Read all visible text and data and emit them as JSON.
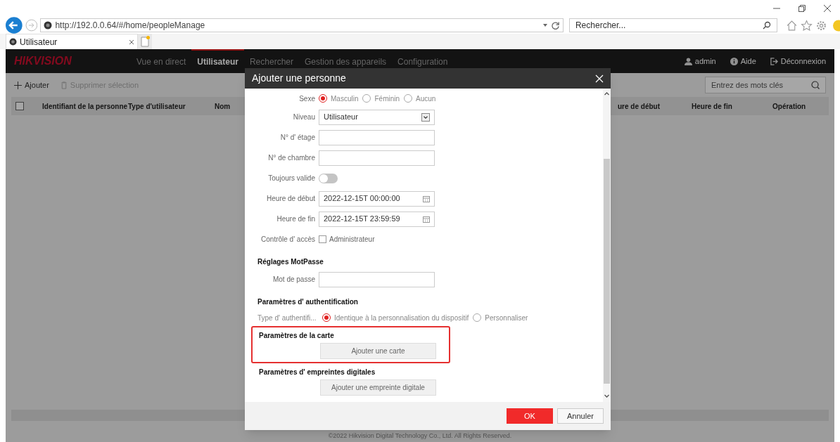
{
  "browser": {
    "url": "http://192.0.0.64/#/home/peopleManage",
    "search_placeholder": "Rechercher...",
    "tab_title": "Utilisateur"
  },
  "app": {
    "logo": "HIKVISION",
    "nav": [
      {
        "label": "Vue en direct",
        "selected": false
      },
      {
        "label": "Utilisateur",
        "selected": true
      },
      {
        "label": "Rechercher",
        "selected": false
      },
      {
        "label": "Gestion des appareils",
        "selected": false
      },
      {
        "label": "Configuration",
        "selected": false
      }
    ],
    "user": "admin",
    "help": "Aide",
    "logout": "Déconnexion"
  },
  "toolbar": {
    "add": "Ajouter",
    "delete": "Supprimer sélection",
    "search_placeholder": "Entrez des mots clés"
  },
  "table": {
    "select_all_checked": false,
    "columns": [
      "Identifiant de la personne",
      "Type d'utilisateur",
      "Nom",
      "ure de début",
      "Heure de fin",
      "Opération"
    ]
  },
  "dialog": {
    "title": "Ajouter une personne",
    "fields": [
      {
        "kind": "radio",
        "label": "Sexe",
        "options": [
          {
            "label": "Masculin",
            "selected": true
          },
          {
            "label": "Féminin",
            "selected": false
          },
          {
            "label": "Aucun",
            "selected": false
          }
        ]
      },
      {
        "kind": "select",
        "label": "Niveau",
        "value": "Utilisateur"
      },
      {
        "kind": "text",
        "label": "N° d'  étage"
      },
      {
        "kind": "text",
        "label": "N° de chambre"
      },
      {
        "kind": "toggle",
        "label": "Toujours valide",
        "on": false
      },
      {
        "kind": "date",
        "label": "Heure de début",
        "value": "2022-12-15T 00:00:00"
      },
      {
        "kind": "date",
        "label": "Heure de fin",
        "value": "2022-12-15T 23:59:59"
      },
      {
        "kind": "checkbox",
        "label": "Contrôle d'  accès",
        "option": "Administrateur",
        "checked": false
      },
      {
        "kind": "section",
        "title": "Réglages MotPasse"
      },
      {
        "kind": "text",
        "label": "Mot de passe"
      },
      {
        "kind": "section",
        "title": "Paramètres d'  authentification"
      },
      {
        "kind": "radio",
        "label": "Type d'  authentifi...",
        "options": [
          {
            "label": "Identique à la personnalisation du dispositif",
            "selected": true
          },
          {
            "label": "Personnaliser",
            "selected": false
          }
        ]
      },
      {
        "kind": "button_section",
        "title": "Paramètres de la carte",
        "button": "Ajouter une carte",
        "highlighted": true
      },
      {
        "kind": "button_section",
        "title": "Paramètres d'  empreintes digitales",
        "button": "Ajouter une empreinte digitale"
      }
    ],
    "ok": "OK",
    "cancel": "Annuler"
  },
  "footer": "©2022 Hikvision Digital Technology Co., Ltd. All Rights Reserved."
}
